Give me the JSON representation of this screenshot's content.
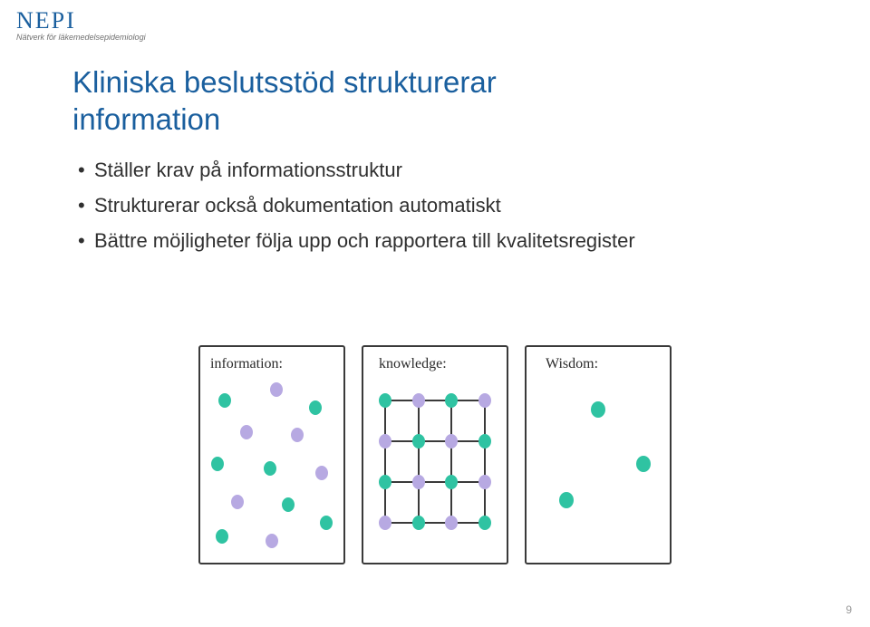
{
  "header": {
    "logo": "NEPI",
    "tagline": "Nätverk för läkemedelsepidemiologi"
  },
  "title_line1": "Kliniska beslutsstöd strukturerar",
  "title_line2": "information",
  "bullets": {
    "b1": "Ställer krav på informationsstruktur",
    "b2": "Strukturerar också dokumentation automatiskt",
    "b3": "Bättre möjligheter följa upp och rapportera till kvalitetsregister"
  },
  "panels": {
    "p1": "information:",
    "p2": "knowledge:",
    "p3": "Wisdom:"
  },
  "page_number": "9"
}
